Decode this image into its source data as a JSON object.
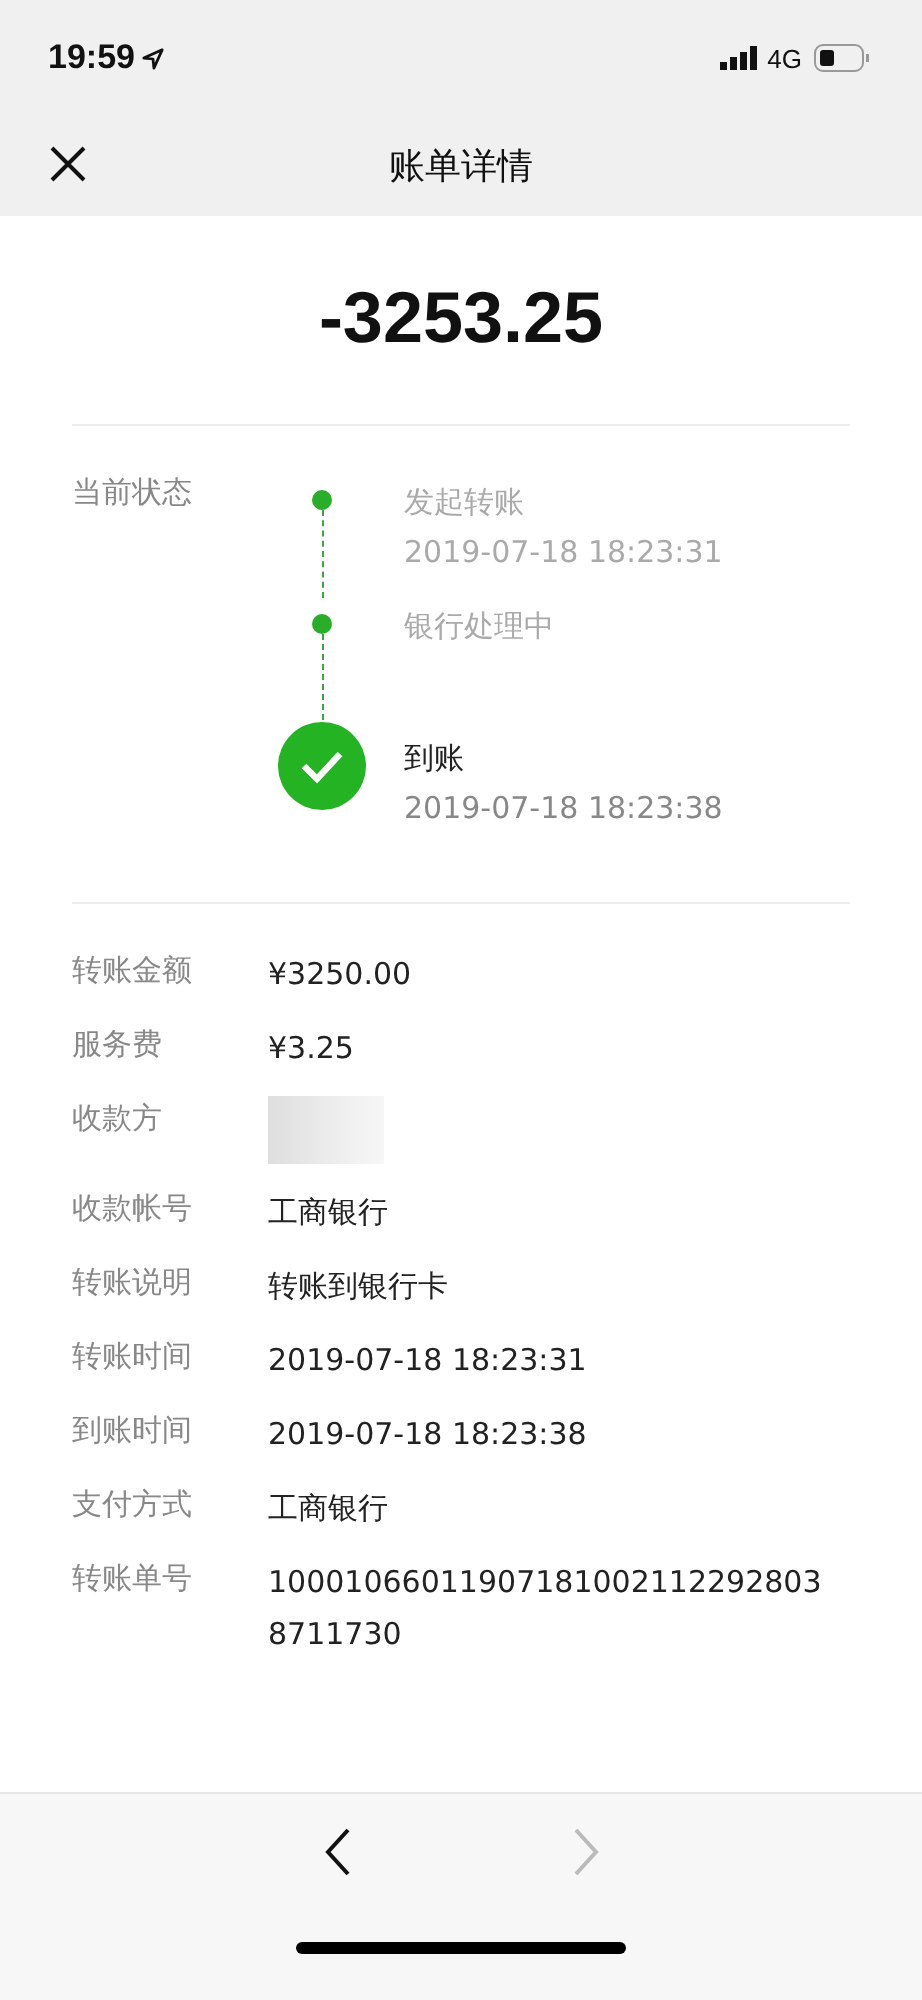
{
  "status_bar": {
    "time": "19:59",
    "network": "4G"
  },
  "nav": {
    "title": "账单详情"
  },
  "amount": "-3253.25",
  "progress": {
    "label": "当前状态",
    "steps": [
      {
        "kind": "dot",
        "title": "发起转账",
        "time": "2019-07-18 18:23:31"
      },
      {
        "kind": "dot",
        "title": "银行处理中"
      },
      {
        "kind": "done",
        "title": "到账",
        "time": "2019-07-18 18:23:38"
      }
    ]
  },
  "details": [
    {
      "label": "转账金额",
      "value": "¥3250.00"
    },
    {
      "label": "服务费",
      "value": "¥3.25"
    },
    {
      "label": "收款方",
      "kind": "redacted"
    },
    {
      "label": "收款帐号",
      "value": "工商银行"
    },
    {
      "label": "转账说明",
      "value": "转账到银行卡"
    },
    {
      "label": "转账时间",
      "value": "2019-07-18 18:23:31"
    },
    {
      "label": "到账时间",
      "value": "2019-07-18 18:23:38"
    },
    {
      "label": "支付方式",
      "value": "工商银行"
    },
    {
      "label": "转账单号",
      "value": "100010660119071810021122928038711730"
    }
  ],
  "toolbar": {
    "back_disabled": false,
    "forward_disabled": true
  }
}
